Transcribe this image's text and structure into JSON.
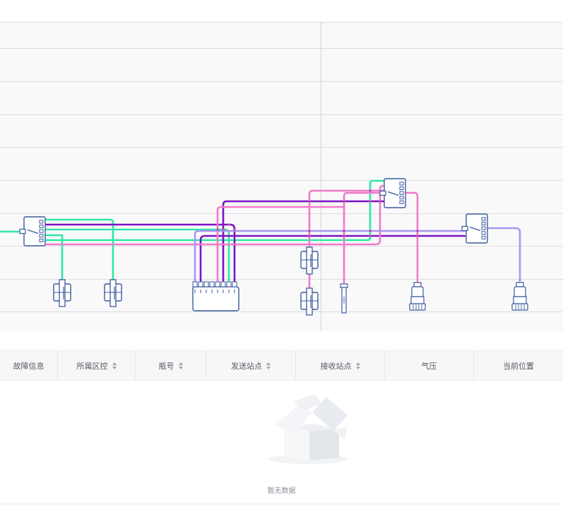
{
  "table": {
    "columns": [
      {
        "label": "故障信息",
        "sortable": false,
        "name": "column-fault-info"
      },
      {
        "label": "所属区控",
        "sortable": true,
        "name": "column-zone-control"
      },
      {
        "label": "瓶号",
        "sortable": true,
        "name": "column-bottle-number"
      },
      {
        "label": "发送站点",
        "sortable": true,
        "name": "column-send-station"
      },
      {
        "label": "接收站点",
        "sortable": true,
        "name": "column-receive-station"
      },
      {
        "label": "气压",
        "sortable": false,
        "name": "column-air-pressure"
      },
      {
        "label": "当前位置",
        "sortable": false,
        "name": "column-current-position"
      }
    ],
    "empty_text": "暂无数据"
  },
  "colors": {
    "green": "#2ee8a8",
    "purple": "#7b12c4",
    "pink": "#f07ac8",
    "lavender": "#a896f0",
    "component": "#3a5a9c",
    "grid": "#dcdcdf",
    "panel": "#f9f9fa"
  },
  "icons": {
    "switch": "diverter-switch-icon",
    "station": "pipe-station-icon",
    "hub": "multi-port-hub-icon",
    "terminal": "valve-terminal-icon",
    "empty": "empty-box-icon"
  }
}
